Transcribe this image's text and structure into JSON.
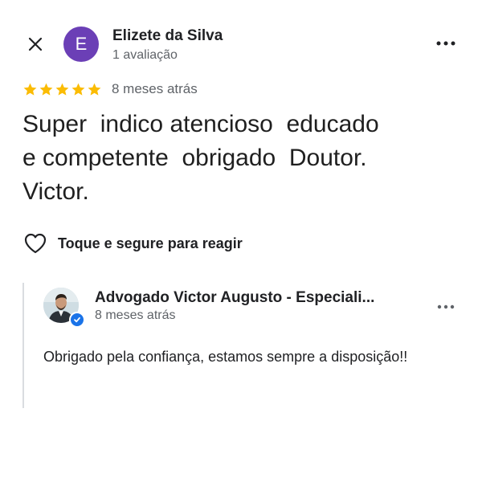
{
  "colors": {
    "avatar_bg": "#6b3fb6",
    "star": "#fbbc04",
    "verified": "#1a73e8"
  },
  "reviewer": {
    "initial": "E",
    "name": "Elizete da Silva",
    "meta": "1 avaliação"
  },
  "review": {
    "rating": 5,
    "rating_max": 5,
    "time": "8 meses atrás",
    "text": "Super  indico atencioso  educado\ne competente  obrigado  Doutor.\nVictor."
  },
  "react": {
    "icon": "heart-outline-icon",
    "label": "Toque e segure para reagir"
  },
  "reply": {
    "owner_name": "Advogado Victor Augusto - Especiali...",
    "time": "8 meses atrás",
    "text": "Obrigado pela confiança, estamos sempre a disposição!!",
    "verified_icon": "verified-check-icon"
  },
  "icons": {
    "close": "close-icon",
    "more": "more-horizontal-icon"
  }
}
